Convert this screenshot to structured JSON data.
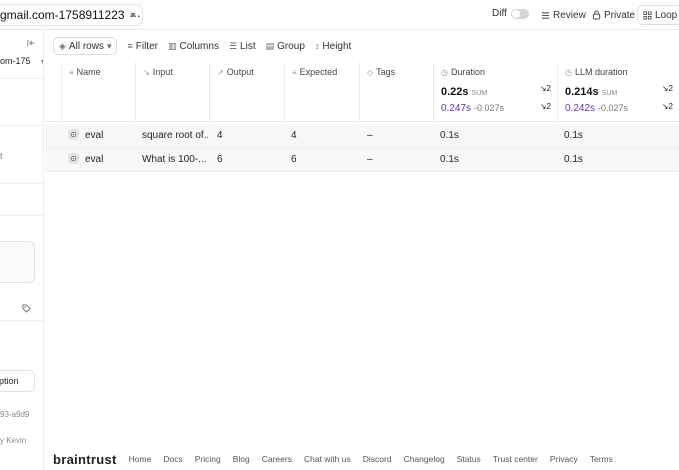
{
  "topbar": {
    "project": "gmail.com-1758911223",
    "more": "···",
    "diff_label": "Diff",
    "review_label": "Review",
    "private_label": "Private",
    "loop_label": "Loop"
  },
  "sidebar": {
    "collapse_icon": "sidebar-collapse-icon",
    "project_snippet": "om-175",
    "text_t": "t",
    "tag_icon": "tag-icon",
    "option_snippet": "ption",
    "id_snippet": "93-a9d9",
    "author_snippet": "y Kevin"
  },
  "toolbar": {
    "all_rows": "All rows",
    "filter": "Filter",
    "columns": "Columns",
    "list": "List",
    "group": "Group",
    "height": "Height"
  },
  "table": {
    "columns": [
      "Name",
      "Input",
      "Output",
      "Expected",
      "Tags",
      "Duration",
      "LLM duration"
    ],
    "duration": {
      "sum": "0.22s",
      "sum_label": "SUM",
      "badge1": "2",
      "compare": "0.247s",
      "delta": "-0.027s",
      "badge2": "2"
    },
    "llm_duration": {
      "sum": "0.214s",
      "sum_label": "SUM",
      "badge1": "2",
      "compare": "0.242s",
      "delta": "-0.027s",
      "badge2": "2"
    },
    "rows": [
      {
        "name": "eval",
        "input": "square root of...",
        "output": "4",
        "expected": "4",
        "tags": "–",
        "duration": "0.1s",
        "llm_duration": "0.1s"
      },
      {
        "name": "eval",
        "input": "What is 100-...",
        "output": "6",
        "expected": "6",
        "tags": "–",
        "duration": "0.1s",
        "llm_duration": "0.1s"
      }
    ]
  },
  "footer": {
    "logo": "braintrust",
    "links": [
      "Home",
      "Docs",
      "Pricing",
      "Blog",
      "Careers",
      "Chat with us",
      "Discord",
      "Changelog",
      "Status",
      "Trust center",
      "Privacy",
      "Terms"
    ]
  },
  "colors": {
    "compare_purple": "#6b2fb3"
  }
}
